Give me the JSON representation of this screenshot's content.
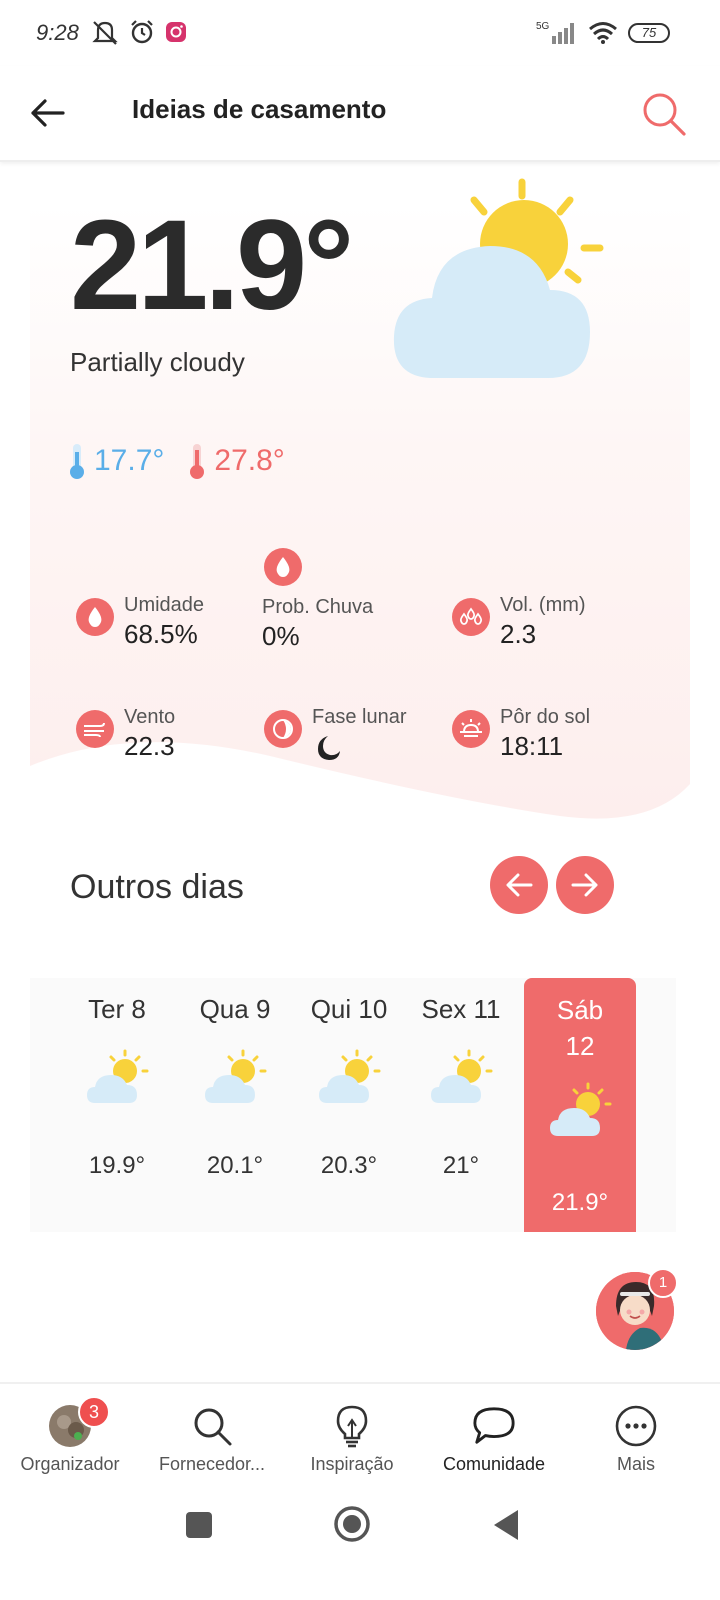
{
  "status_bar": {
    "time": "9:28",
    "network": "5G",
    "battery": "75"
  },
  "header": {
    "title": "Ideias de casamento"
  },
  "weather": {
    "temperature": "21.9°",
    "condition": "Partially cloudy",
    "min_temp": "17.7°",
    "max_temp": "27.8°",
    "stats": {
      "humidity": {
        "label": "Umidade",
        "value": "68.5%"
      },
      "rain_prob": {
        "label": "Prob. Chuva",
        "value": "0%"
      },
      "volume": {
        "label": "Vol. (mm)",
        "value": "2.3"
      },
      "wind": {
        "label": "Vento",
        "value": "22.3"
      },
      "moon_phase": {
        "label": "Fase lunar",
        "icon": "crescent-moon-icon"
      },
      "sunset": {
        "label": "Pôr do sol",
        "value": "18:11"
      }
    }
  },
  "other_days": {
    "title": "Outros dias",
    "days": [
      {
        "name": "Ter 8",
        "temp": "19.9°"
      },
      {
        "name": "Qua 9",
        "temp": "20.1°"
      },
      {
        "name": "Qui 10",
        "temp": "20.3°"
      },
      {
        "name": "Sex 11",
        "temp": "21°"
      },
      {
        "name": "Sáb 12",
        "temp": "21.9°",
        "selected": true
      }
    ]
  },
  "chat_badge": "1",
  "bottom_nav": {
    "items": [
      {
        "label": "Organizador",
        "badge": "3"
      },
      {
        "label": "Fornecedor..."
      },
      {
        "label": "Inspiração"
      },
      {
        "label": "Comunidade",
        "active": true
      },
      {
        "label": "Mais"
      }
    ]
  },
  "colors": {
    "accent": "#ef6b6b",
    "min_temp": "#5aaee8",
    "text": "#222222"
  }
}
